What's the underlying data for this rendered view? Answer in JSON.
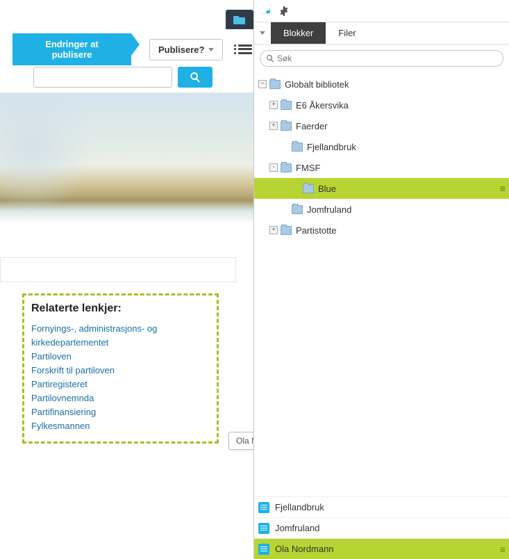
{
  "left": {
    "publish_changes": "Endringer at publisere",
    "publish_question": "Publisere?",
    "search_value": ""
  },
  "related": {
    "title": "Relaterte lenkjer:",
    "links": [
      "Fornyings-, administrasjons- og kirkedepartementet",
      "Partiloven",
      "Forskrift til partiloven",
      "Partiregisteret",
      "Partilovnemnda",
      "Partifinansiering",
      "Fylkesmannen"
    ]
  },
  "tooltip": "Ola Nordmann",
  "right": {
    "tabs": {
      "blocks": "Blokker",
      "files": "Filer"
    },
    "search_placeholder": "Søk",
    "tree": {
      "root": "Globalt bibliotek",
      "children": [
        {
          "label": "E6 Åkersvika",
          "expander": "+"
        },
        {
          "label": "Faerder",
          "expander": "+"
        },
        {
          "label": "Fjellandbruk",
          "expander": ""
        },
        {
          "label": "FMSF",
          "expander": "-",
          "children": [
            {
              "label": "Blue",
              "selected": true
            }
          ]
        },
        {
          "label": "Jomfruland",
          "expander": ""
        },
        {
          "label": "Partistotte",
          "expander": "+"
        }
      ]
    },
    "bottom": [
      {
        "label": "Fjellandbruk"
      },
      {
        "label": "Jomfruland"
      },
      {
        "label": "Ola Nordmann",
        "selected": true
      }
    ]
  }
}
